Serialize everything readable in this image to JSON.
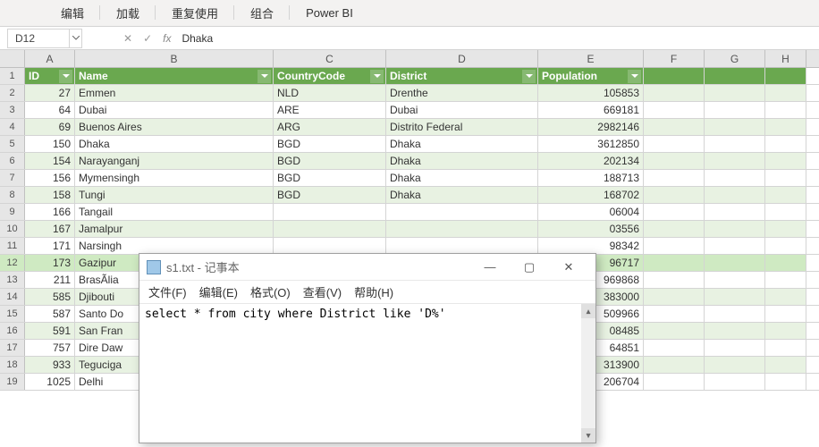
{
  "ribbon": {
    "items": [
      "编辑",
      "加载",
      "重复使用",
      "组合",
      "Power BI"
    ]
  },
  "formula": {
    "nameBox": "D12",
    "value": "Dhaka"
  },
  "columns": [
    "A",
    "B",
    "C",
    "D",
    "E",
    "F",
    "G",
    "H"
  ],
  "header": {
    "A": "ID",
    "B": "Name",
    "C": "CountryCode",
    "D": "District",
    "E": "Population"
  },
  "rows": [
    {
      "r": 2,
      "A": "27",
      "B": "Emmen",
      "C": "NLD",
      "D": "Drenthe",
      "E": "105853"
    },
    {
      "r": 3,
      "A": "64",
      "B": "Dubai",
      "C": "ARE",
      "D": "Dubai",
      "E": "669181"
    },
    {
      "r": 4,
      "A": "69",
      "B": "Buenos Aires",
      "C": "ARG",
      "D": "Distrito Federal",
      "E": "2982146"
    },
    {
      "r": 5,
      "A": "150",
      "B": "Dhaka",
      "C": "BGD",
      "D": "Dhaka",
      "E": "3612850"
    },
    {
      "r": 6,
      "A": "154",
      "B": "Narayanganj",
      "C": "BGD",
      "D": "Dhaka",
      "E": "202134"
    },
    {
      "r": 7,
      "A": "156",
      "B": "Mymensingh",
      "C": "BGD",
      "D": "Dhaka",
      "E": "188713"
    },
    {
      "r": 8,
      "A": "158",
      "B": "Tungi",
      "C": "BGD",
      "D": "Dhaka",
      "E": "168702"
    },
    {
      "r": 9,
      "A": "166",
      "B": "Tangail",
      "C": "",
      "D": "",
      "E": "06004"
    },
    {
      "r": 10,
      "A": "167",
      "B": "Jamalpur",
      "C": "",
      "D": "",
      "E": "03556"
    },
    {
      "r": 11,
      "A": "171",
      "B": "Narsingh",
      "C": "",
      "D": "",
      "E": "98342"
    },
    {
      "r": 12,
      "A": "173",
      "B": "Gazipur",
      "C": "",
      "D": "",
      "E": "96717"
    },
    {
      "r": 13,
      "A": "211",
      "B": "BrasÃ­lia",
      "C": "",
      "D": "",
      "E": "969868"
    },
    {
      "r": 14,
      "A": "585",
      "B": "Djibouti",
      "C": "",
      "D": "",
      "E": "383000"
    },
    {
      "r": 15,
      "A": "587",
      "B": "Santo Do",
      "C": "",
      "D": "",
      "E": "509966"
    },
    {
      "r": 16,
      "A": "591",
      "B": "San Fran",
      "C": "",
      "D": "",
      "E": "08485"
    },
    {
      "r": 17,
      "A": "757",
      "B": "Dire Daw",
      "C": "",
      "D": "",
      "E": "64851"
    },
    {
      "r": 18,
      "A": "933",
      "B": "Teguciga",
      "C": "",
      "D": "",
      "E": "313900"
    },
    {
      "r": 19,
      "A": "1025",
      "B": "Delhi",
      "C": "",
      "D": "",
      "E": "206704"
    }
  ],
  "chart_data": {
    "type": "table",
    "title": "city table rows where District like 'D%'",
    "columns": [
      "ID",
      "Name",
      "CountryCode",
      "District",
      "Population"
    ],
    "rows": [
      [
        27,
        "Emmen",
        "NLD",
        "Drenthe",
        105853
      ],
      [
        64,
        "Dubai",
        "ARE",
        "Dubai",
        669181
      ],
      [
        69,
        "Buenos Aires",
        "ARG",
        "Distrito Federal",
        2982146
      ],
      [
        150,
        "Dhaka",
        "BGD",
        "Dhaka",
        3612850
      ],
      [
        154,
        "Narayanganj",
        "BGD",
        "Dhaka",
        202134
      ],
      [
        156,
        "Mymensingh",
        "BGD",
        "Dhaka",
        188713
      ],
      [
        158,
        "Tungi",
        "BGD",
        "Dhaka",
        168702
      ]
    ]
  },
  "notepad": {
    "title": "s1.txt - 记事本",
    "menus": [
      "文件(F)",
      "编辑(E)",
      "格式(O)",
      "查看(V)",
      "帮助(H)"
    ],
    "content": "select * from city where District like 'D%'"
  }
}
